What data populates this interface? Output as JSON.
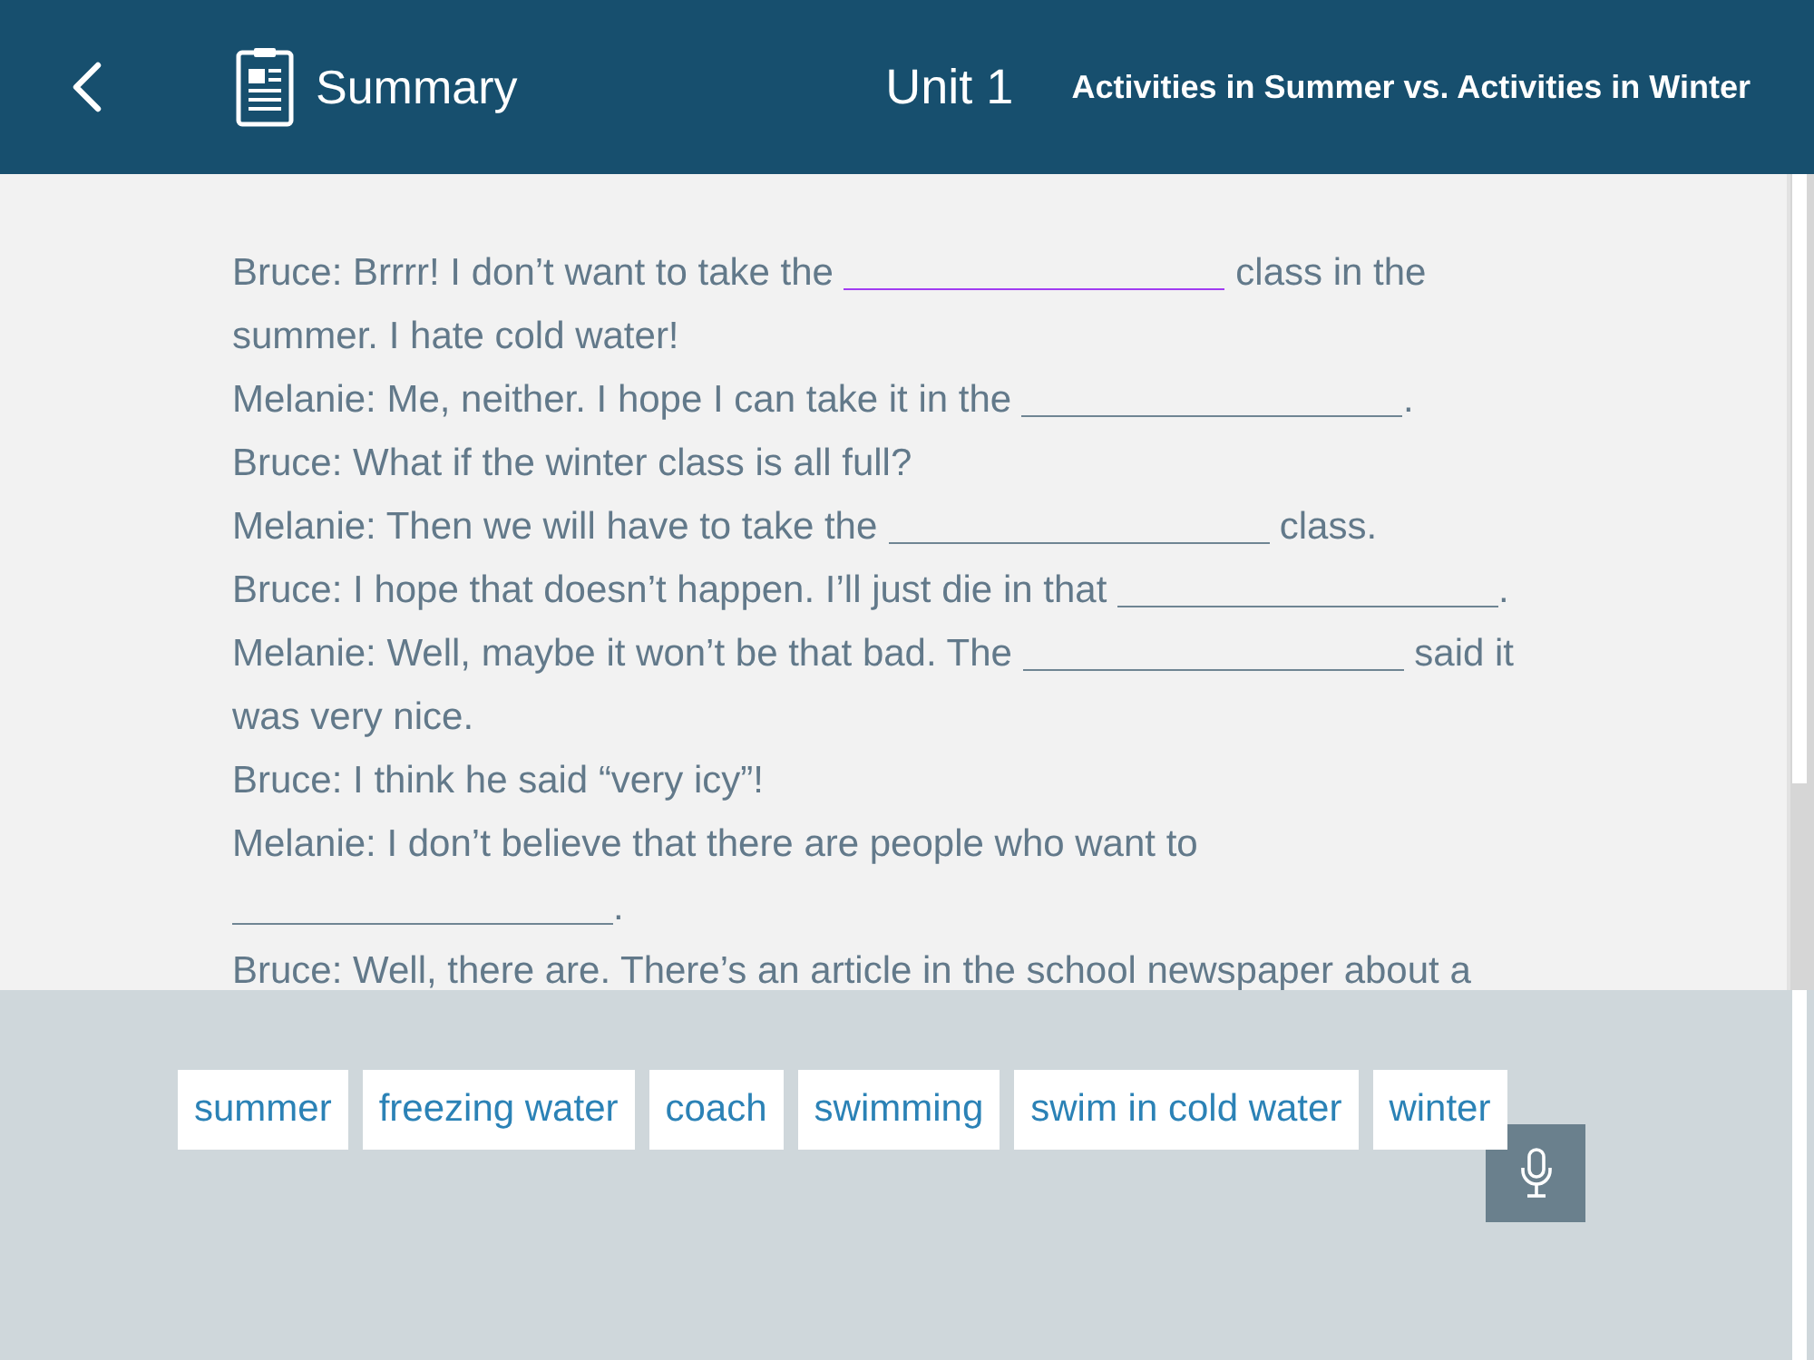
{
  "header": {
    "section": "Summary",
    "unit": "Unit 1",
    "title": "Activities in Summer vs. Activities in Winter"
  },
  "dialogue": [
    {
      "segments": [
        {
          "kind": "text",
          "text": "Bruce: Brrrr! I don’t want to take the"
        },
        {
          "kind": "blank",
          "selected": true
        },
        {
          "kind": "text",
          "text": "class in the"
        }
      ]
    },
    {
      "segments": [
        {
          "kind": "text",
          "text": "summer. I hate cold water!"
        }
      ]
    },
    {
      "segments": [
        {
          "kind": "text",
          "text": "Melanie: Me, neither. I hope I can take it in the"
        },
        {
          "kind": "blank",
          "selected": false
        },
        {
          "kind": "punct",
          "text": "."
        }
      ]
    },
    {
      "segments": [
        {
          "kind": "text",
          "text": "Bruce: What if the winter class is all full?"
        }
      ]
    },
    {
      "segments": [
        {
          "kind": "text",
          "text": "Melanie: Then we will have to take the"
        },
        {
          "kind": "blank",
          "selected": false
        },
        {
          "kind": "text",
          "text": "class."
        }
      ]
    },
    {
      "segments": [
        {
          "kind": "text",
          "text": "Bruce: I hope that doesn’t happen. I’ll just die in that"
        },
        {
          "kind": "blank",
          "selected": false
        },
        {
          "kind": "punct",
          "text": "."
        }
      ]
    },
    {
      "segments": [
        {
          "kind": "text",
          "text": "Melanie: Well, maybe it won’t be that bad. The"
        },
        {
          "kind": "blank",
          "selected": false
        },
        {
          "kind": "text",
          "text": "said it"
        }
      ]
    },
    {
      "segments": [
        {
          "kind": "text",
          "text": "was very nice."
        }
      ]
    },
    {
      "segments": [
        {
          "kind": "text",
          "text": "Bruce: I think he said “very icy”!"
        }
      ]
    },
    {
      "segments": [
        {
          "kind": "text",
          "text": "Melanie: I don’t believe that there are people who want to"
        }
      ]
    },
    {
      "segments": [
        {
          "kind": "blank",
          "selected": false
        },
        {
          "kind": "punct",
          "text": "."
        }
      ]
    },
    {
      "segments": [
        {
          "kind": "text",
          "text": "Bruce: Well, there are. There’s an article in the school newspaper about a"
        }
      ]
    }
  ],
  "word_bank": [
    "summer",
    "freezing water",
    "coach",
    "swimming",
    "swim in cold water",
    "winter"
  ]
}
